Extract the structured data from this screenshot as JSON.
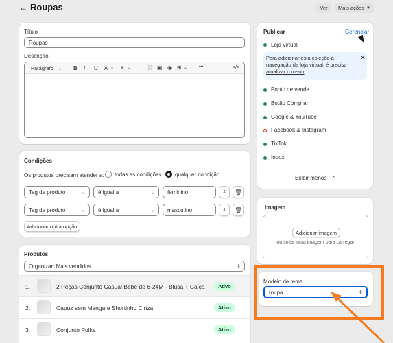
{
  "header": {
    "back_icon": "arrow-left-icon",
    "title": "Roupas",
    "view_button": "Ver",
    "more_actions": "Mais ações"
  },
  "details": {
    "title_label": "Título",
    "title_value": "Roupas",
    "description_label": "Descrição",
    "paragraph_select": "Parágrafo",
    "toolbar": {
      "bold": "B",
      "italic": "I",
      "underline": "U",
      "text_color": "A",
      "more": "•••",
      "code": "</>"
    }
  },
  "conditions": {
    "title": "Condições",
    "must_match_label": "Os produtos precisam atender a:",
    "option_all": "todas as condições",
    "option_any": "qualquer condição",
    "rows": [
      {
        "field": "Tag de produto",
        "operator": "é igual a",
        "value": "feminino"
      },
      {
        "field": "Tag de produto",
        "operator": "é igual a",
        "value": "masculino"
      }
    ],
    "add_button": "Adicionar outra opção"
  },
  "products": {
    "title": "Produtos",
    "sort_label": "Organizar: Mais vendidos",
    "items": [
      {
        "index": "1.",
        "name": "2 Peças Conjunto Casual Bebê de 6-24M - Blusa + Calça",
        "status": "Ativo"
      },
      {
        "index": "2.",
        "name": "Capuz sem Manga e Shortinho Cinza",
        "status": "Ativo"
      },
      {
        "index": "3.",
        "name": "Conjunto Polka",
        "status": "Ativo"
      }
    ]
  },
  "publish": {
    "title": "Publicar",
    "manage_link": "Gerenciar",
    "online_store": "Loja virtual",
    "banner_text": "Para adicionar esta coleção à navegação da loja virtual, é preciso",
    "banner_link": "atualizar o menu",
    "channels": [
      {
        "name": "Ponto de venda",
        "active": true
      },
      {
        "name": "Botão Comprar",
        "active": true
      },
      {
        "name": "Google & YouTube",
        "active": true
      },
      {
        "name": "Facebook & Instagram",
        "active": false
      },
      {
        "name": "TikTok",
        "active": true
      },
      {
        "name": "Inbox",
        "active": true
      }
    ],
    "show_less": "Exibir menos"
  },
  "image": {
    "title": "Imagem",
    "add_button": "Adicionar imagem",
    "drop_hint": "ou soltar uma imagem para carregar"
  },
  "theme": {
    "label": "Modelo de tema",
    "value": "roupa"
  },
  "colors": {
    "accent_orange": "#f47b20",
    "active_green": "#29845a",
    "inactive_red": "#e51c00",
    "link_blue": "#005bd3"
  }
}
